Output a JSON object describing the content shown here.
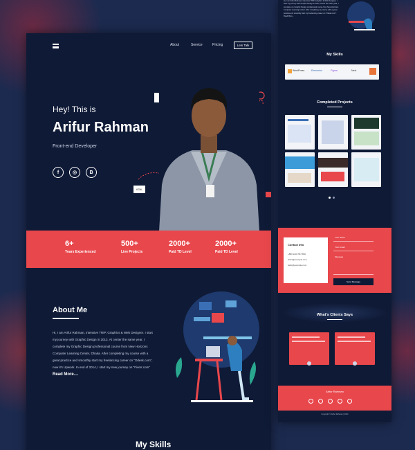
{
  "nav": {
    "links": [
      "About",
      "Service",
      "Pricing"
    ],
    "cta": "Lets Talk"
  },
  "hero": {
    "greeting": "Hey! This is",
    "name": "Arifur Rahman",
    "role": "Front-end Developer",
    "socials": [
      "facebook-icon",
      "dribbble-icon",
      "behance-icon"
    ],
    "tag_html": "HTML",
    "tag_css": "CSS"
  },
  "stats": [
    {
      "value": "6+",
      "label": "Years Experienced"
    },
    {
      "value": "500+",
      "label": "Live Projects"
    },
    {
      "value": "2000+",
      "label": "Paid TD Level"
    },
    {
      "value": "2000+",
      "label": "Paid TD Level"
    }
  ],
  "about": {
    "title": "About Me",
    "text": "Hi, I am Arifur Rahman, Intensive TRIP, Graphics & Web Designer. I start my journey with Graphic Design in 2013. At center the same year, I complete my Graphic Design professional course from New Horizons Computer Learning Center, Dhaka. After completing my course with a great practice and smoothly start my freelancing career on \"Odesk.com\", now it's Upwork. In end of 2014, I start my new journey on \"Fiverr.com\"",
    "more": "Read More...."
  },
  "skills_title": "My Skills",
  "side": {
    "intro": "Hi, I am Arifur Rahman, Intensive TRIP, Graphics & Web Designer. I start my journey with Graphic Design in 2013, center the same year, I complete my Graphic Design professional course from New Horizons Computer Learning Center. After completing my course with a great practice and smoothly start my freelancing career on \"Odesk.com\". Read More...",
    "skills_title": "My Skills",
    "skills": [
      "WordPress",
      "Elementor",
      "Figma",
      "Next",
      "HTML"
    ],
    "projects_title": "Completed Projects",
    "contact_title": "Contact Info",
    "contact_lines": [
      "+880 1234 567 890",
      "arifur@example.com",
      "hello@example.com"
    ],
    "form_fields": [
      "Your Name",
      "Your Email",
      "Message"
    ],
    "form_button": "Send Message",
    "clients_title": "What's Clients Says",
    "footer_name": "Arifur Rahman",
    "copyright": "Copyright © Arifur Rahman | 2024"
  },
  "colors": {
    "accent": "#e8474c",
    "dark": "#0f1a36",
    "page": "#1c2a4f"
  }
}
